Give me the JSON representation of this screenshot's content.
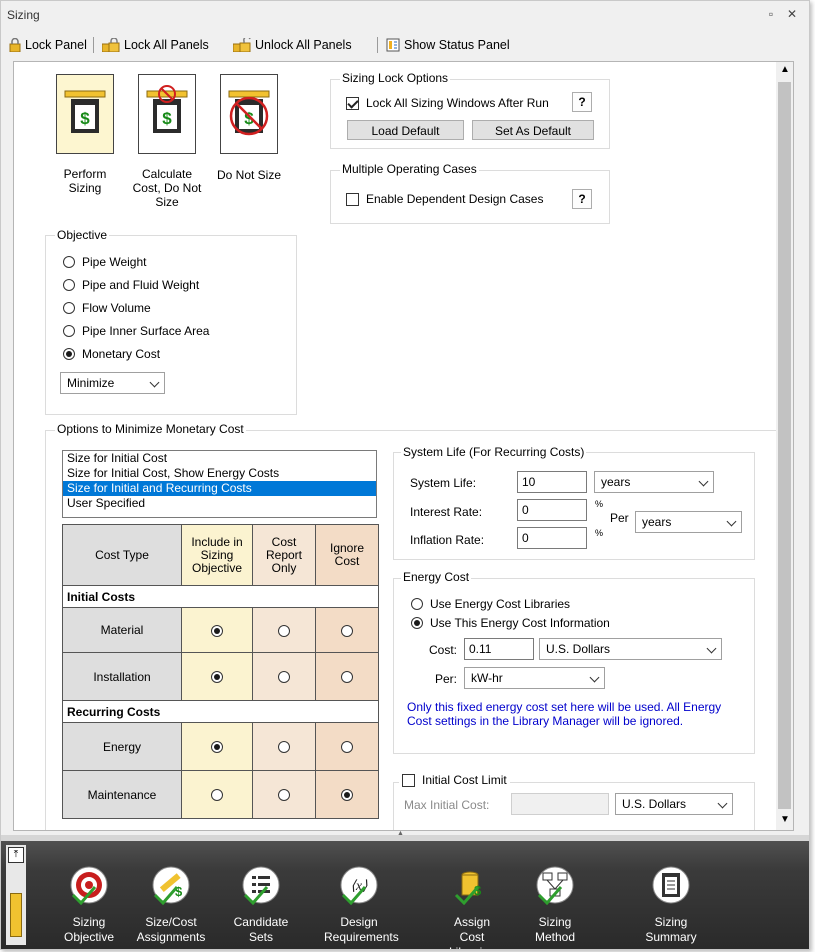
{
  "window": {
    "title": "Sizing"
  },
  "toolbar": {
    "lock_panel": "Lock Panel",
    "lock_all": "Lock All Panels",
    "unlock_all": "Unlock All Panels",
    "show_status": "Show Status Panel"
  },
  "modes": [
    {
      "label": "Perform Sizing",
      "selected": true
    },
    {
      "label": "Calculate Cost, Do Not Size",
      "selected": false
    },
    {
      "label": "Do Not Size",
      "selected": false
    }
  ],
  "sizing_lock": {
    "group_label": "Sizing Lock Options",
    "lock_all_label": "Lock All Sizing Windows After Run",
    "lock_all_checked": true,
    "load_default": "Load Default",
    "set_default": "Set As Default",
    "help": "?"
  },
  "multiple_cases": {
    "group_label": "Multiple Operating Cases",
    "enable_label": "Enable Dependent Design Cases",
    "enable_checked": false,
    "help": "?"
  },
  "objective": {
    "group_label": "Objective",
    "options": [
      "Pipe Weight",
      "Pipe and Fluid Weight",
      "Flow Volume",
      "Pipe Inner Surface Area",
      "Monetary Cost"
    ],
    "selected_index": 4,
    "direction": "Minimize"
  },
  "minimize_cost": {
    "group_label": "Options to Minimize Monetary Cost",
    "list": [
      "Size for Initial Cost",
      "Size for Initial Cost, Show Energy Costs",
      "Size for Initial and Recurring Costs",
      "User Specified"
    ],
    "selected_index": 2,
    "table": {
      "header_cost_type": "Cost Type",
      "header_include": "Include in Sizing Objective",
      "header_report": "Cost Report Only",
      "header_ignore": "Ignore Cost",
      "section_initial": "Initial Costs",
      "section_recurring": "Recurring Costs",
      "rows": [
        {
          "name": "Material",
          "selection": 0
        },
        {
          "name": "Installation",
          "selection": 0
        },
        {
          "name": "Energy",
          "selection": 0
        },
        {
          "name": "Maintenance",
          "selection": 2
        }
      ]
    }
  },
  "system_life": {
    "group_label": "System Life (For Recurring Costs)",
    "life_label": "System Life:",
    "life_value": "10",
    "life_unit": "years",
    "interest_label": "Interest Rate:",
    "interest_value": "0",
    "inflation_label": "Inflation Rate:",
    "inflation_value": "0",
    "percent": "%",
    "per_label": "Per",
    "per_unit": "years"
  },
  "energy_cost": {
    "group_label": "Energy Cost",
    "use_libraries": "Use Energy Cost Libraries",
    "use_this": "Use This Energy Cost Information",
    "selected_index": 1,
    "cost_label": "Cost:",
    "cost_value": "0.11",
    "currency": "U.S. Dollars",
    "per_label": "Per:",
    "per_unit": "kW-hr",
    "note": "Only this fixed energy cost set here will be used. All Energy Cost settings in the Library Manager will be ignored.",
    "note_color": "#0000cc"
  },
  "initial_limit": {
    "label": "Initial Cost Limit",
    "checked": false,
    "max_label": "Max Initial Cost:",
    "max_value": "",
    "currency": "U.S. Dollars"
  },
  "nav": [
    {
      "line1": "Sizing",
      "line2": "Objective",
      "icon": "target-icon"
    },
    {
      "line1": "Size/Cost",
      "line2": "Assignments",
      "icon": "ruler-dollar-icon"
    },
    {
      "line1": "Candidate",
      "line2": "Sets",
      "icon": "list-icon"
    },
    {
      "line1": "Design",
      "line2": "Requirements",
      "icon": "x-variable-icon"
    },
    {
      "line1": "Assign",
      "line2": "Cost Libraries",
      "icon": "cost-library-icon"
    },
    {
      "line1": "Sizing",
      "line2": "Method",
      "icon": "flowchart-icon"
    },
    {
      "line1": "Sizing",
      "line2": "Summary",
      "icon": "clipboard-icon"
    }
  ],
  "colors": {
    "table_include": "#fbf3d0",
    "table_report": "#f5e6d6",
    "table_ignore": "#f3dcc6",
    "table_cell_gray": "#dedede",
    "list_selected": "#0078d7",
    "nav_check": "#2e9e2e"
  }
}
